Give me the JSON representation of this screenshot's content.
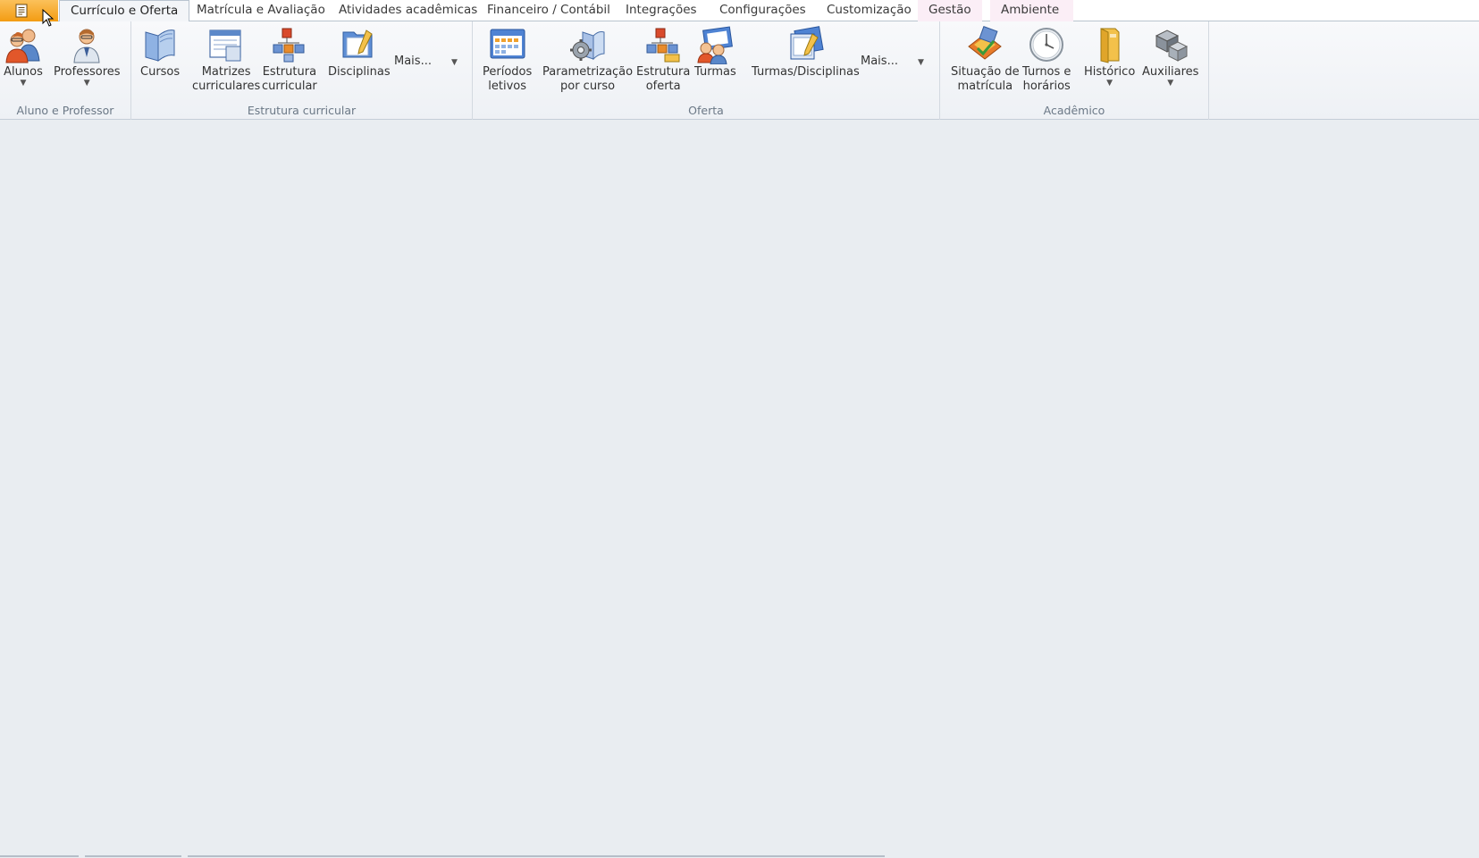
{
  "tabs": [
    {
      "label": "Currículo e Oferta",
      "active": true
    },
    {
      "label": "Matrícula e Avaliação"
    },
    {
      "label": "Atividades acadêmicas"
    },
    {
      "label": "Financeiro / Contábil"
    },
    {
      "label": "Integrações"
    },
    {
      "label": "Configurações"
    },
    {
      "label": "Customização"
    },
    {
      "label": "Gestão"
    },
    {
      "label": "Ambiente"
    }
  ],
  "groups": {
    "aluno_professor": {
      "label": "Aluno e Professor",
      "alunos": "Alunos",
      "professores": "Professores"
    },
    "estrutura": {
      "label": "Estrutura curricular",
      "cursos": "Cursos",
      "matrizes_1": "Matrizes",
      "matrizes_2": "curriculares",
      "estrutura_1": "Estrutura",
      "estrutura_2": "curricular",
      "disciplinas": "Disciplinas",
      "mais": "Mais..."
    },
    "oferta": {
      "label": "Oferta",
      "periodos_1": "Períodos",
      "periodos_2": "letivos",
      "param_1": "Parametrização",
      "param_2": "por curso",
      "estrutura_1": "Estrutura",
      "estrutura_2": "oferta",
      "turmas": "Turmas",
      "turmas_disciplinas": "Turmas/Disciplinas",
      "mais": "Mais..."
    },
    "academico": {
      "label": "Acadêmico",
      "situacao_1": "Situação de",
      "situacao_2": "matrícula",
      "turnos_1": "Turnos e",
      "turnos_2": "horários",
      "historico": "Histórico",
      "auxiliares": "Auxiliares"
    }
  },
  "colors": {
    "app_button": "#f39c12",
    "workspace": "#e9edf1",
    "group_label": "#6b7886"
  }
}
